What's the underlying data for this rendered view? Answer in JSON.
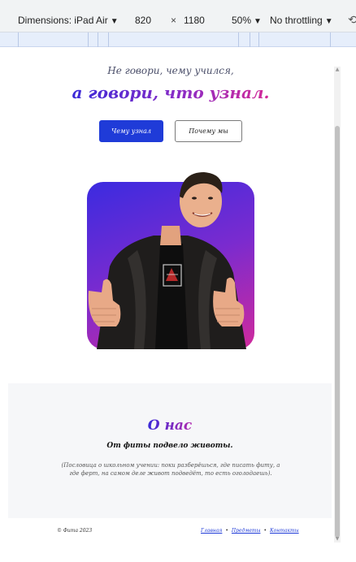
{
  "devtools": {
    "dimensions_label": "Dimensions: iPad Air",
    "width": "820",
    "times": "×",
    "height": "1180",
    "zoom": "50%",
    "throttling": "No throttling",
    "caret": "▼",
    "rotate_icon": "rotate-icon"
  },
  "hero": {
    "subtitle": "Не говори, чему учился,",
    "title": "а говори, что узнал.",
    "primary_button": "Чему узнал",
    "secondary_button": "Почему мы"
  },
  "colors": {
    "accent_blue": "#1f3bd8",
    "gradient_start": "#3b2be0",
    "gradient_end": "#d02a9c",
    "section_bg": "#f6f7f9"
  },
  "about": {
    "title": "О нас",
    "subtitle": "От фиты подвело животы.",
    "text": "(Пословица о школьном учении: поки разберёшься, где писать фиту, а где ферт, на самом деле живот подведёт, то есть оголодаешь).",
    "photo_alt": "photo"
  },
  "footer": {
    "copyright": "© Фита 2023",
    "links": [
      "Главная",
      "Предметы",
      "Контакты"
    ],
    "separator": "•"
  }
}
